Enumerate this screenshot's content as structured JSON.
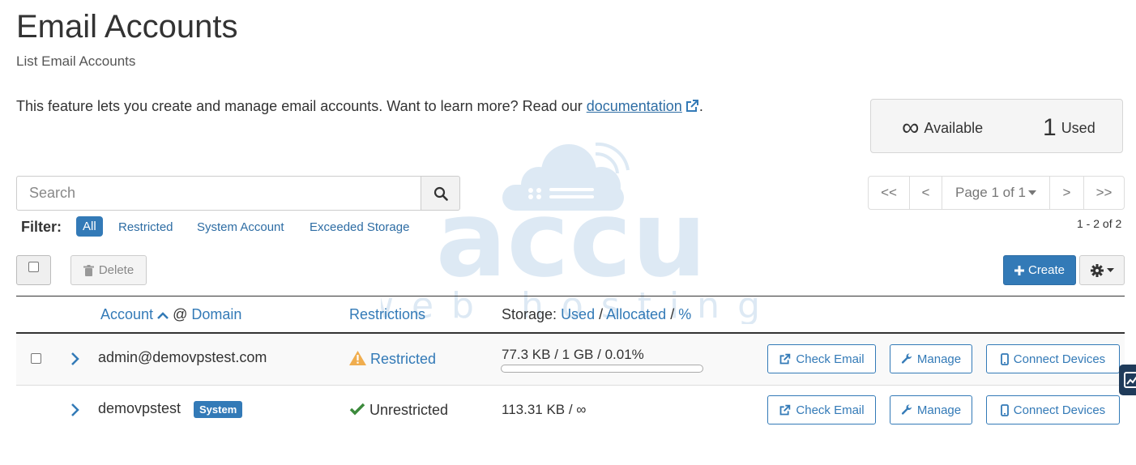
{
  "page": {
    "title": "Email Accounts",
    "subtitle": "List Email Accounts",
    "intro_text": "This feature lets you create and manage email accounts. Want to learn more? Read our ",
    "intro_link": "documentation",
    "intro_end": "."
  },
  "stats": {
    "available_value": "∞",
    "available_label": "Available",
    "used_value": "1",
    "used_label": "Used"
  },
  "search": {
    "placeholder": "Search"
  },
  "filter": {
    "label": "Filter:",
    "options": [
      "All",
      "Restricted",
      "System Account",
      "Exceeded Storage"
    ]
  },
  "pagination": {
    "first": "<<",
    "prev": "<",
    "page_label": "Page 1 of 1",
    "next": ">",
    "last": ">>",
    "range": "1 - 2 of 2"
  },
  "toolbar": {
    "delete_label": "Delete",
    "create_label": "Create"
  },
  "table": {
    "col_account": "Account",
    "col_at": "@",
    "col_domain": "Domain",
    "col_restrictions": "Restrictions",
    "col_storage": "Storage:",
    "col_used": "Used",
    "col_allocated": "Allocated",
    "col_percent": "%",
    "sep": "/",
    "rows": [
      {
        "account": "admin@demovpstest.com",
        "badge": "",
        "restriction": "Restricted",
        "storage": "77.3 KB / 1 GB / 0.01%",
        "usage_percent": 0.01
      },
      {
        "account": "demovpstest",
        "badge": "System",
        "restriction": "Unrestricted",
        "storage": "113.31 KB / ∞"
      }
    ],
    "actions": {
      "check_email": "Check Email",
      "manage": "Manage",
      "connect_devices": "Connect Devices"
    }
  },
  "watermark": {
    "line1": "accu",
    "line2": "web hosting"
  },
  "colors": {
    "primary": "#337ab7",
    "warning": "#f0ad4e",
    "success": "#3c8a3c"
  }
}
